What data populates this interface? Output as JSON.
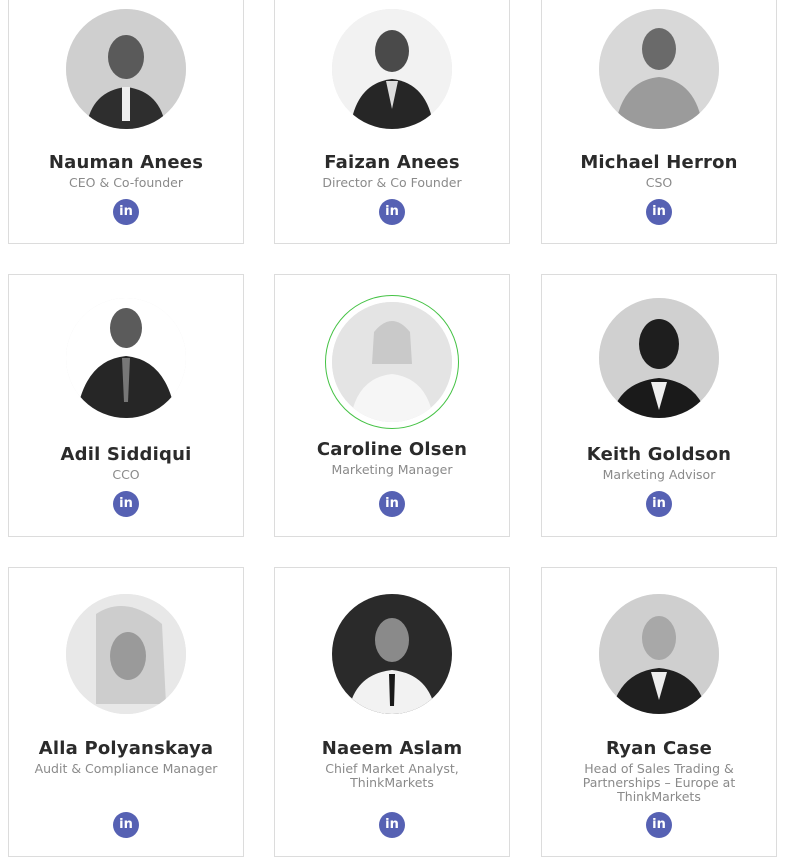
{
  "team": [
    {
      "name": "Nauman Anees",
      "role": "CEO & Co-founder",
      "icon": "linkedin-icon",
      "linkedin": "in"
    },
    {
      "name": "Faizan Anees",
      "role": "Director & Co Founder",
      "icon": "linkedin-icon",
      "linkedin": "in"
    },
    {
      "name": "Michael Herron",
      "role": "CSO",
      "icon": "linkedin-icon",
      "linkedin": "in"
    },
    {
      "name": "Adil Siddiqui",
      "role": "CCO",
      "icon": "linkedin-icon",
      "linkedin": "in"
    },
    {
      "name": "Caroline Olsen",
      "role": "Marketing Manager",
      "icon": "linkedin-icon",
      "linkedin": "in"
    },
    {
      "name": "Keith Goldson",
      "role": "Marketing Advisor",
      "icon": "linkedin-icon",
      "linkedin": "in"
    },
    {
      "name": "Alla Polyanskaya",
      "role": "Audit & Compliance Manager",
      "icon": "linkedin-icon",
      "linkedin": "in"
    },
    {
      "name": "Naeem Aslam",
      "role": "Chief Market Analyst, ThinkMarkets",
      "icon": "linkedin-icon",
      "linkedin": "in"
    },
    {
      "name": "Ryan Case",
      "role": "Head of Sales Trading & Partnerships – Europe at ThinkMarkets",
      "icon": "linkedin-icon",
      "linkedin": "in"
    }
  ],
  "colors": {
    "linkedin": "#5661b3",
    "hover_ring": "#44c244",
    "card_border": "#dcdcdc"
  }
}
